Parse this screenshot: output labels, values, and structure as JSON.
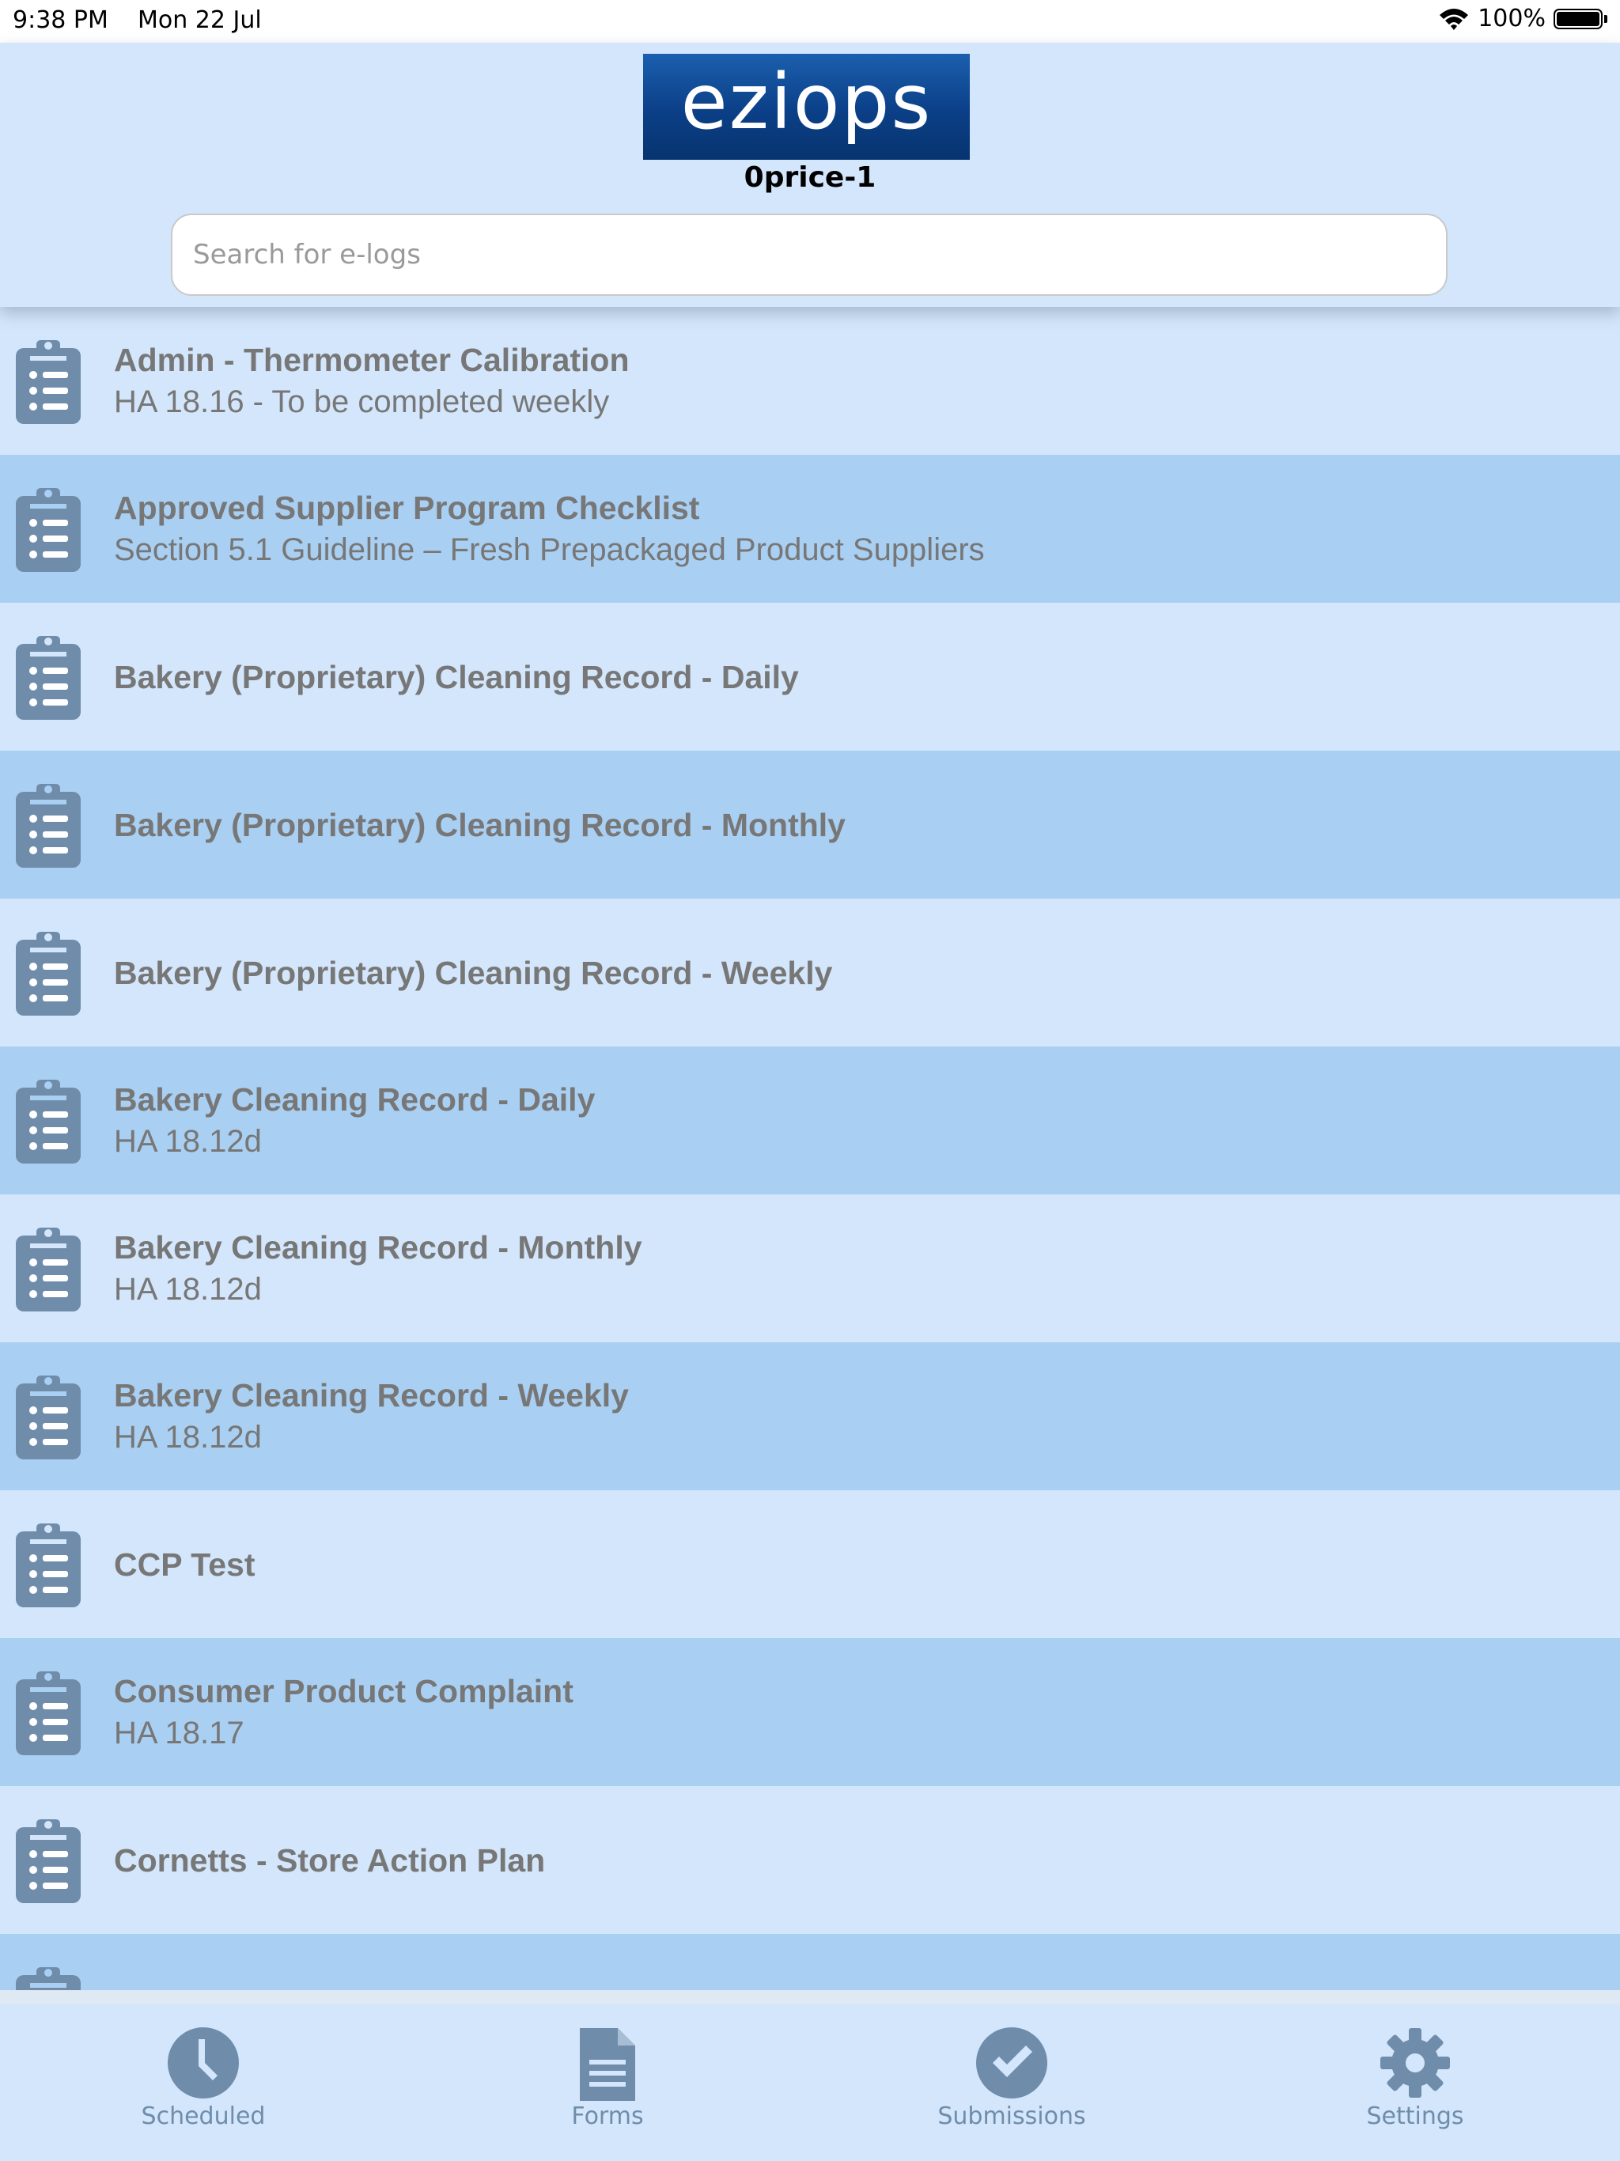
{
  "status": {
    "time": "9:38 PM",
    "date": "Mon 22 Jul",
    "battery": "100%"
  },
  "header": {
    "logo_text": "eziops",
    "store_name": "0price-1",
    "search_placeholder": "Search for e-logs"
  },
  "list": {
    "items": [
      {
        "title": "Admin - Thermometer Calibration",
        "subtitle": "HA 18.16 - To be completed weekly"
      },
      {
        "title": "Approved Supplier Program Checklist",
        "subtitle": "Section 5.1 Guideline – Fresh Prepackaged Product Suppliers"
      },
      {
        "title": "Bakery (Proprietary) Cleaning Record - Daily",
        "subtitle": ""
      },
      {
        "title": "Bakery (Proprietary) Cleaning Record - Monthly",
        "subtitle": ""
      },
      {
        "title": "Bakery (Proprietary) Cleaning Record - Weekly",
        "subtitle": ""
      },
      {
        "title": "Bakery Cleaning Record - Daily",
        "subtitle": "HA 18.12d"
      },
      {
        "title": "Bakery Cleaning Record - Monthly",
        "subtitle": "HA 18.12d"
      },
      {
        "title": "Bakery Cleaning Record - Weekly",
        "subtitle": "HA 18.12d"
      },
      {
        "title": "CCP Test",
        "subtitle": ""
      },
      {
        "title": "Consumer Product Complaint",
        "subtitle": "HA 18.17"
      },
      {
        "title": "Cornetts - Store Action Plan",
        "subtitle": ""
      },
      {
        "title": "",
        "subtitle": ""
      }
    ]
  },
  "tabs": {
    "scheduled": "Scheduled",
    "forms": "Forms",
    "submissions": "Submissions",
    "settings": "Settings"
  },
  "colors": {
    "background": "#d3e6fb",
    "row_alt": "#a9cff2",
    "icon": "#6f8dab",
    "logo": "#0b3f87"
  }
}
